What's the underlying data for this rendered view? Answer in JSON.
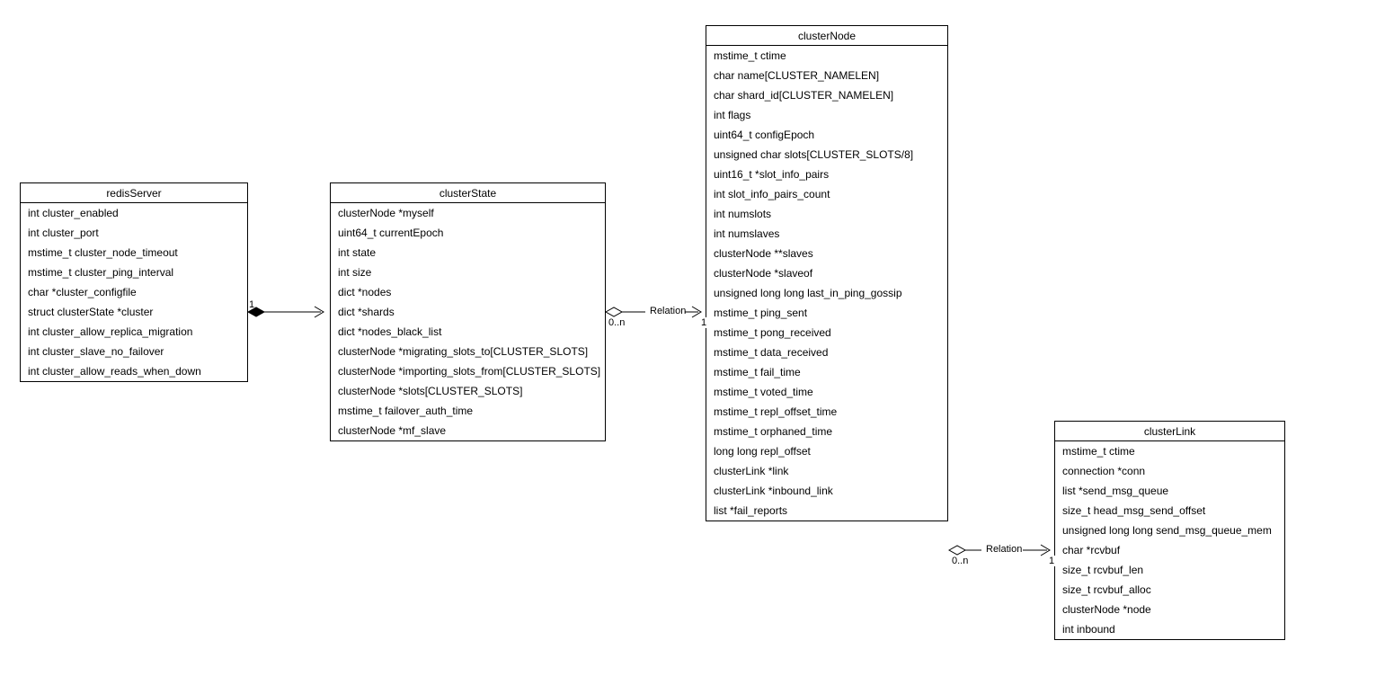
{
  "boxes": {
    "redisServer": {
      "title": "redisServer",
      "attrs": [
        "int cluster_enabled",
        "int cluster_port",
        "mstime_t cluster_node_timeout",
        "mstime_t cluster_ping_interval",
        "char *cluster_configfile",
        "struct clusterState *cluster",
        "int cluster_allow_replica_migration",
        "int cluster_slave_no_failover",
        "int cluster_allow_reads_when_down"
      ]
    },
    "clusterState": {
      "title": "clusterState",
      "attrs": [
        "clusterNode *myself",
        "uint64_t currentEpoch",
        "int state",
        "int size",
        "dict *nodes",
        "dict *shards",
        "dict *nodes_black_list",
        "clusterNode *migrating_slots_to[CLUSTER_SLOTS]",
        "clusterNode *importing_slots_from[CLUSTER_SLOTS]",
        "clusterNode *slots[CLUSTER_SLOTS]",
        "mstime_t failover_auth_time",
        "clusterNode *mf_slave"
      ]
    },
    "clusterNode": {
      "title": "clusterNode",
      "attrs": [
        "mstime_t ctime",
        "char name[CLUSTER_NAMELEN]",
        "char shard_id[CLUSTER_NAMELEN]",
        "int flags",
        "uint64_t configEpoch",
        "unsigned char slots[CLUSTER_SLOTS/8]",
        "uint16_t *slot_info_pairs",
        "int slot_info_pairs_count",
        "int numslots",
        "int numslaves",
        "clusterNode **slaves",
        "clusterNode *slaveof",
        "unsigned long long last_in_ping_gossip",
        "mstime_t ping_sent",
        "mstime_t pong_received",
        "mstime_t data_received",
        "mstime_t fail_time",
        "mstime_t voted_time",
        "mstime_t repl_offset_time",
        "mstime_t orphaned_time",
        "long long repl_offset",
        "clusterLink *link",
        "clusterLink *inbound_link",
        "list *fail_reports"
      ]
    },
    "clusterLink": {
      "title": "clusterLink",
      "attrs": [
        "mstime_t ctime",
        "connection *conn",
        "list *send_msg_queue",
        "size_t head_msg_send_offset",
        "unsigned long long send_msg_queue_mem",
        "char *rcvbuf",
        "size_t rcvbuf_len",
        "size_t rcvbuf_alloc",
        "clusterNode *node",
        "int inbound"
      ]
    }
  },
  "relations": {
    "r1": {
      "label": "Relation",
      "leftMult": "0..n",
      "rightMult": "1"
    },
    "r2": {
      "label": "Relation",
      "leftMult": "0..n",
      "rightMult": "1"
    },
    "comp1": {
      "leftMult": "1",
      "rightMult": ""
    }
  }
}
